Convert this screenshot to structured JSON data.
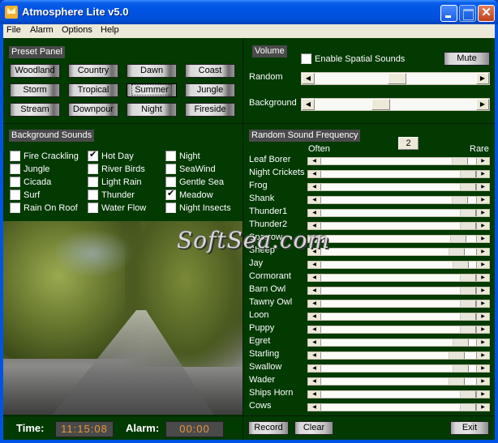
{
  "window": {
    "title": "Atmosphere Lite v5.0",
    "controls": {
      "minimize": "minimize-icon",
      "maximize": "maximize-icon",
      "close": "close-icon"
    },
    "close_glyph": "✕"
  },
  "menu": [
    "File",
    "Alarm",
    "Options",
    "Help"
  ],
  "preset_panel": {
    "label": "Preset Panel",
    "buttons": [
      "Woodland",
      "Country",
      "Dawn",
      "Coast",
      "Storm",
      "Tropical",
      "Summer",
      "Jungle",
      "Stream",
      "Downpour",
      "Night",
      "Fireside"
    ],
    "focused": "Summer"
  },
  "volume": {
    "label": "Volume",
    "spatial_label": "Enable Spatial Sounds",
    "spatial_checked": false,
    "mute_label": "Mute",
    "sliders": [
      {
        "label": "Random",
        "value": 0.51
      },
      {
        "label": "Background",
        "value": 0.4
      }
    ]
  },
  "background_sounds": {
    "label": "Background Sounds",
    "items": [
      {
        "label": "Fire Crackling",
        "checked": false
      },
      {
        "label": "Jungle",
        "checked": false
      },
      {
        "label": "Cicada",
        "checked": false
      },
      {
        "label": "Surf",
        "checked": false
      },
      {
        "label": "Rain On Roof",
        "checked": false
      },
      {
        "label": "Hot Day",
        "checked": true
      },
      {
        "label": "River Birds",
        "checked": false
      },
      {
        "label": "Light Rain",
        "checked": false
      },
      {
        "label": "Thunder",
        "checked": false
      },
      {
        "label": "Water Flow",
        "checked": false
      },
      {
        "label": "Night",
        "checked": false
      },
      {
        "label": "SeaWind",
        "checked": false
      },
      {
        "label": "Gentle Sea",
        "checked": false
      },
      {
        "label": "Meadow",
        "checked": true
      },
      {
        "label": "Night Insects",
        "checked": false
      }
    ]
  },
  "random_frequency": {
    "label": "Random Sound Frequency",
    "value_box": "2",
    "often_label": "Often",
    "rare_label": "Rare",
    "items": [
      {
        "label": "Leaf Borer",
        "value": 0.94
      },
      {
        "label": "Night Crickets",
        "value": 1.0
      },
      {
        "label": "Frog",
        "value": 1.0
      },
      {
        "label": "Shank",
        "value": 0.94
      },
      {
        "label": "Thunder1",
        "value": 1.0
      },
      {
        "label": "Thunder2",
        "value": 1.0
      },
      {
        "label": "Sparrow",
        "value": 0.93
      },
      {
        "label": "Sheep",
        "value": 0.92
      },
      {
        "label": "Jay",
        "value": 0.95
      },
      {
        "label": "Cormorant",
        "value": 1.0
      },
      {
        "label": "Barn Owl",
        "value": 1.0
      },
      {
        "label": "Tawny Owl",
        "value": 1.0
      },
      {
        "label": "Loon",
        "value": 1.0
      },
      {
        "label": "Puppy",
        "value": 1.0
      },
      {
        "label": "Egret",
        "value": 0.95
      },
      {
        "label": "Starling",
        "value": 0.92
      },
      {
        "label": "Swallow",
        "value": 0.95
      },
      {
        "label": "Wader",
        "value": 0.92
      },
      {
        "label": "Ships Horn",
        "value": 1.0
      },
      {
        "label": "Cows",
        "value": 1.0
      }
    ]
  },
  "status": {
    "time_label": "Time:",
    "time_value": "11:15:08",
    "alarm_label": "Alarm:",
    "alarm_value": "00:00"
  },
  "footer_buttons": {
    "record": "Record",
    "clear": "Clear",
    "exit": "Exit"
  },
  "watermark": "SoftSea.com",
  "colors": {
    "panel_bg": "#023a02",
    "lcd_text": "#e8963a",
    "titlebar": "#0054e3"
  }
}
